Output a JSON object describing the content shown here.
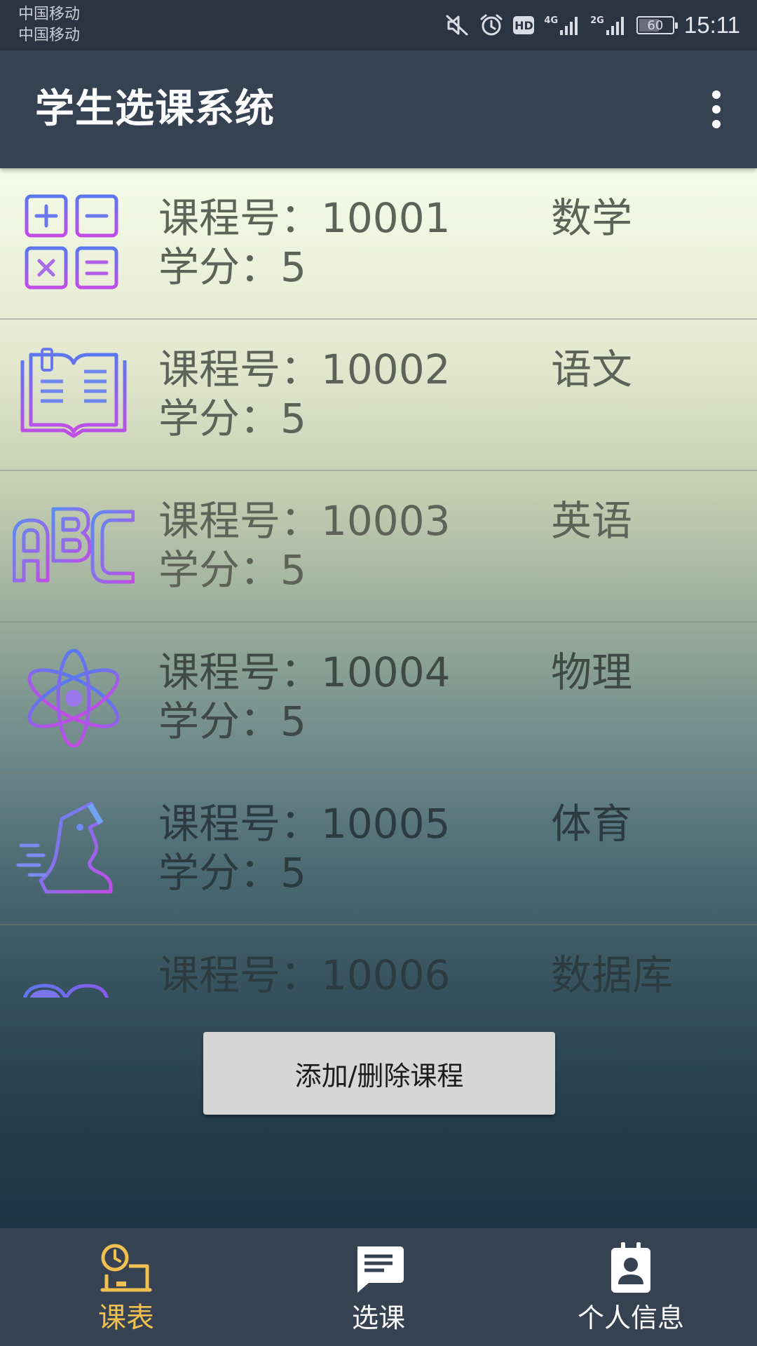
{
  "status_bar": {
    "carrier_1": "中国移动",
    "carrier_2": "中国移动",
    "hd": "HD",
    "network_1": "4G",
    "network_2": "2G",
    "battery": "60",
    "time": "15:11",
    "icons": [
      "mute-icon",
      "alarm-icon",
      "hd-icon",
      "signal-4g-icon",
      "signal-2g-icon",
      "battery-icon"
    ]
  },
  "app_bar": {
    "title": "学生选课系统",
    "menu_icon": "more-vert-icon"
  },
  "courses": [
    {
      "number": "课程号：10001",
      "credit": "学分：5",
      "name": "数学",
      "icon": "calculator-icon"
    },
    {
      "number": "课程号：10002",
      "credit": "学分：5",
      "name": "语文",
      "icon": "open-book-icon"
    },
    {
      "number": "课程号：10003",
      "credit": "学分：5",
      "name": "英语",
      "icon": "abc-letters-icon"
    },
    {
      "number": "课程号：10004",
      "credit": "学分：5",
      "name": "物理",
      "icon": "atom-icon"
    },
    {
      "number": "课程号：10005",
      "credit": "学分：5",
      "name": "体育",
      "icon": "running-shoe-icon"
    },
    {
      "number": "课程号：10006",
      "credit": "",
      "name": "数据库",
      "icon": "database-icon"
    }
  ],
  "actions": {
    "add_remove_label": "添加/删除课程"
  },
  "bottom_nav": {
    "active_color": "#f0c050",
    "items": [
      {
        "label": "课表",
        "icon": "schedule-icon",
        "active": true
      },
      {
        "label": "选课",
        "icon": "message-icon",
        "active": false
      },
      {
        "label": "个人信息",
        "icon": "contact-badge-icon",
        "active": false
      }
    ]
  }
}
